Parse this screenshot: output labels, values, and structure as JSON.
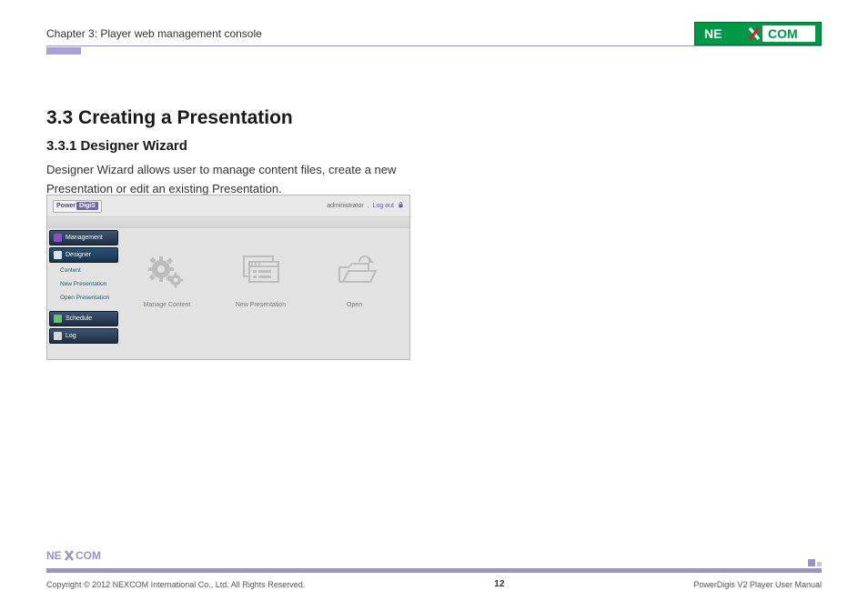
{
  "header": {
    "chapter_label": "Chapter 3: Player web management console",
    "brand": {
      "left": "NE",
      "mid": "X",
      "right": "COM"
    }
  },
  "section": {
    "title": "3.3 Creating a Presentation",
    "subtitle": "3.3.1 Designer Wizard",
    "paragraph": "Designer Wizard allows user to manage content files, create a new Presentation or edit an existing Presentation."
  },
  "console": {
    "brand": {
      "part1": "Power",
      "part2": "DigiS"
    },
    "login": {
      "username": "administrator",
      "separator": ",",
      "logout_label": "Log out",
      "lock_icon": "lock-icon"
    },
    "sidebar": {
      "items": [
        {
          "label": "Management",
          "name": "sidebar-item-management",
          "icon": "management-icon"
        },
        {
          "label": "Designer",
          "name": "sidebar-item-designer",
          "icon": "designer-icon"
        }
      ],
      "sub_items": [
        {
          "label": "Content",
          "name": "sidebar-sub-content"
        },
        {
          "label": "New Presentation",
          "name": "sidebar-sub-new-presentation"
        },
        {
          "label": "Open Presentation",
          "name": "sidebar-sub-open-presentation"
        }
      ],
      "items_after": [
        {
          "label": "Schedule",
          "name": "sidebar-item-schedule",
          "icon": "schedule-icon"
        },
        {
          "label": "Log",
          "name": "sidebar-item-log",
          "icon": "log-icon"
        }
      ]
    },
    "cards": [
      {
        "label": "Manage Content",
        "name": "card-manage-content",
        "icon": "gears-icon"
      },
      {
        "label": "New Presentation",
        "name": "card-new-presentation",
        "icon": "window-list-icon"
      },
      {
        "label": "Open",
        "name": "card-open",
        "icon": "folder-open-icon"
      }
    ]
  },
  "footer": {
    "brand": {
      "left": "NE",
      "mid": "X",
      "right": "COM"
    },
    "copyright": "Copyright © 2012 NEXCOM International Co., Ltd. All Rights Reserved.",
    "page_number": "12",
    "manual_name": "PowerDigis V2 Player User Manual"
  }
}
